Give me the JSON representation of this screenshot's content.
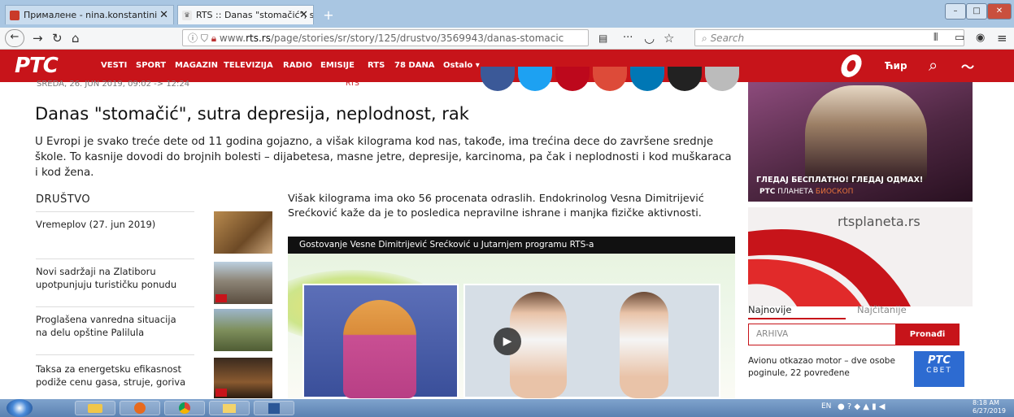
{
  "browser": {
    "tabs": [
      {
        "label": "Прималене - nina.konstantini"
      },
      {
        "label": "RTS :: Danas \"stomačić\", sutra"
      }
    ],
    "url_prefix": "www.",
    "url_domain": "rts.rs",
    "url_path": "/page/stories/sr/story/125/drustvo/3569943/danas-stomacic",
    "search_placeholder": "Search",
    "more_dots": "···"
  },
  "site": {
    "logo": "РТС",
    "menu": [
      "VESTI",
      "SPORT",
      "MAGAZIN",
      "TELEVIZIJA",
      "RADIO",
      "EMISIJE",
      "RTS",
      "78 DANA",
      "Ostalo ▾"
    ],
    "script_toggle": "Ћир"
  },
  "article": {
    "dateline": "SREDA, 26. JUN 2019, 09:02 -> 12:24",
    "source": "RTS",
    "headline": "Danas \"stomačić\", sutra depresija, neplodnost, rak",
    "lead": "U Evropi je svako treće dete od 11 godina gojazno, a višak kilograma kod nas, takođe, ima trećina dece do završene srednje škole. To kasnije dovodi do brojnih bolesti – dijabetesa, masne jetre, depresije, karcinoma, pa čak i neplodnosti i kod muškaraca i kod žena.",
    "body": "Višak kilograma ima oko 56 procenata odraslih. Endokrinolog Vesna Dimitrijević Srećković kaže da je to posledica nepravilne ishrane i manjka fizičke aktivnosti.",
    "video_title": "Gostovanje Vesne Dimitrijević Srećković u Jutarnjem programu RTS-a"
  },
  "sidebar": {
    "section": "DRUŠTVO",
    "items": [
      {
        "text": "Vremeplov (27. jun 2019)"
      },
      {
        "text": "Novi sadržaji na Zlatiboru upotpunjuju turističku ponudu"
      },
      {
        "text": "Proglašena vanredna situacija na delu opštine Palilula"
      },
      {
        "text": "Taksa za energetsku efikasnost podiže cenu gasa, struje, goriva"
      }
    ]
  },
  "right": {
    "ad1_text": "ГЛЕДАЈ БЕСПЛАТНО! ГЛЕДАЈ ОДМАХ!",
    "ad1_brand": "РТС",
    "ad1_brand_sub": "ПЛАНЕТА",
    "ad1_brand_tag": "БИОСКОП",
    "ad2_text": "rtsplaneta.rs",
    "tab_newest": "Najnovije",
    "tab_most_read": "Najčitanije",
    "archive_placeholder": "ARHIVA",
    "archive_button": "Pronađi",
    "news_item": "Avionu otkazao motor – dve osobe poginule, 22 povređene",
    "rts_box_title": "РТС",
    "rts_box_sub": "СВЕТ"
  },
  "taskbar": {
    "lang": "EN",
    "time": "8:18 AM",
    "date": "6/27/2019"
  },
  "colors": {
    "brand_red": "#c7141a",
    "share_colors": [
      "#3b5998",
      "#1da1f2",
      "#bd081c",
      "#dd4b39",
      "#0077b5",
      "#222222",
      "#bbbbbb"
    ]
  }
}
